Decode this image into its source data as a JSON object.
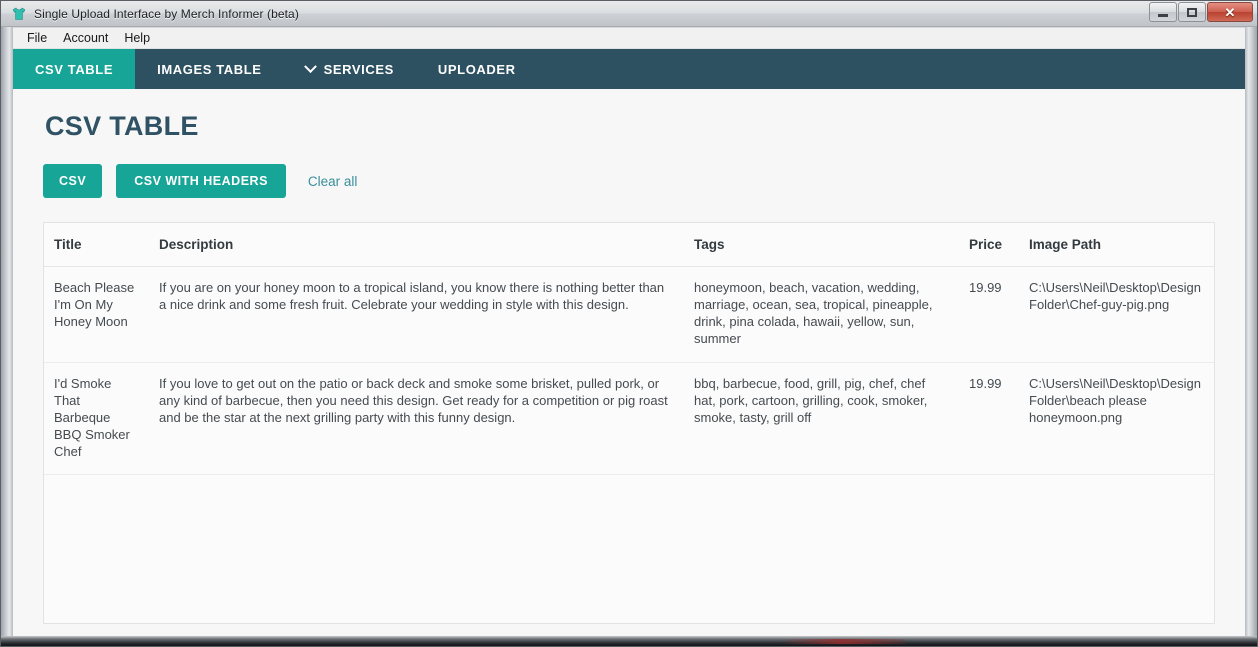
{
  "window": {
    "title": "Single Upload Interface by Merch Informer (beta)",
    "icon": "tshirt-icon",
    "controls": {
      "minimize": "–",
      "maximize": "□",
      "close": "✕"
    }
  },
  "menubar": {
    "items": [
      {
        "label": "File"
      },
      {
        "label": "Account"
      },
      {
        "label": "Help"
      }
    ]
  },
  "navbar": {
    "items": [
      {
        "label": "CSV TABLE",
        "active": true,
        "icon": null
      },
      {
        "label": "IMAGES TABLE",
        "active": false,
        "icon": null
      },
      {
        "label": "SERVICES",
        "active": false,
        "icon": "chevron-down-icon"
      },
      {
        "label": "UPLOADER",
        "active": false,
        "icon": null
      }
    ]
  },
  "page": {
    "title": "CSV TABLE",
    "buttons": {
      "csv": "CSV",
      "csv_with_headers": "CSV WITH HEADERS",
      "clear_all": "Clear all"
    }
  },
  "table": {
    "columns": [
      "Title",
      "Description",
      "Tags",
      "Price",
      "Image Path"
    ],
    "rows": [
      {
        "title": "Beach Please I'm On My Honey Moon",
        "description": "If you are on your honey moon to a tropical island, you know there is nothing better than a nice drink and some fresh fruit. Celebrate your wedding in style with this design.",
        "tags": "honeymoon, beach, vacation, wedding, marriage, ocean, sea, tropical, pineapple, drink, pina colada, hawaii, yellow, sun, summer",
        "price": "19.99",
        "image_path": "C:\\Users\\Neil\\Desktop\\Design Folder\\Chef-guy-pig.png"
      },
      {
        "title": "I'd Smoke That Barbeque BBQ Smoker Chef",
        "description": "If you love to get out on the patio or back deck and smoke some brisket, pulled pork, or any kind of barbecue, then you need this design. Get ready for a competition or pig roast and be the star at the next grilling party with this funny design.",
        "tags": "bbq, barbecue, food, grill, pig, chef, chef hat, pork, cartoon, grilling, cook, smoker, smoke, tasty, grill off",
        "price": "19.99",
        "image_path": "C:\\Users\\Neil\\Desktop\\Design Folder\\beach please honeymoon.png"
      }
    ]
  },
  "colors": {
    "teal": "#16a596",
    "nav_dark": "#2d5161",
    "heading": "#2f5265",
    "link": "#3a8f9c"
  }
}
